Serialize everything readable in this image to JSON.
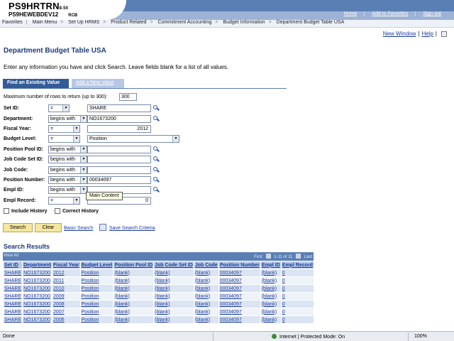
{
  "header": {
    "brand_main": "PS9HRTRN",
    "brand_version": "8.50",
    "brand_db": "PS9HEWEBDEV12",
    "brand_code": "RCB",
    "links": [
      "Home",
      "Add to Favorites",
      "Sign out"
    ]
  },
  "breadcrumb": [
    "Favorites",
    "Main Menu",
    "Set Up HRMS",
    "Product Related",
    "Commitment Accounting",
    "Budget Information",
    "Department Budget Table USA"
  ],
  "utility": {
    "new_window": "New Window",
    "help": "Help"
  },
  "page": {
    "title": "Department Budget Table USA",
    "instructions": "Enter any information you have and click Search. Leave fields blank for a list of all values."
  },
  "tabs": {
    "existing": "Find an Existing Value",
    "new": "Add a New Value"
  },
  "maxrows": {
    "label": "Maximum number of rows to return (up to 300):",
    "value": "300"
  },
  "fields": [
    {
      "label": "Set ID:",
      "op": "=",
      "value": "SHARE"
    },
    {
      "label": "Department:",
      "op": "begins with",
      "value": "NO1673200"
    },
    {
      "label": "Fiscal Year:",
      "op": "=",
      "value": "2012"
    },
    {
      "label": "Budget Level:",
      "op": "=",
      "value": "Position"
    },
    {
      "label": "Position Pool ID:",
      "op": "begins with",
      "value": ""
    },
    {
      "label": "Job Code Set ID:",
      "op": "begins with",
      "value": ""
    },
    {
      "label": "Job Code:",
      "op": "begins with",
      "value": ""
    },
    {
      "label": "Position Number:",
      "op": "begins with",
      "value": "00034097"
    },
    {
      "label": "Empl ID:",
      "op": "begins with",
      "value": ""
    },
    {
      "label": "Empl Record:",
      "op": "=",
      "value": "0"
    }
  ],
  "tooltip": "Main Content",
  "checkboxes": {
    "include_history": "Include History",
    "correct_history": "Correct History"
  },
  "buttons": {
    "search": "Search",
    "clear": "Clear",
    "basic_search": "Basic Search",
    "save_criteria": "Save Search Criteria"
  },
  "results": {
    "title": "Search Results",
    "view_all": "View All",
    "first": "First",
    "range": "1-11 of 11",
    "last": "Last",
    "columns": [
      "Set ID",
      "Department",
      "Fiscal Year",
      "Budget Level",
      "Position Pool ID",
      "Job Code Set ID",
      "Job Code",
      "Position Number",
      "Empl ID",
      "Empl Record"
    ],
    "rows": [
      [
        "SHARE",
        "NO1673200",
        "2012",
        "Position",
        "(blank)",
        "(blank)",
        "(blank)",
        "00034097",
        "(blank)",
        "0"
      ],
      [
        "SHARE",
        "NO1673200",
        "2011",
        "Position",
        "(blank)",
        "(blank)",
        "(blank)",
        "00034097",
        "(blank)",
        "0"
      ],
      [
        "SHARE",
        "NO1673200",
        "2010",
        "Position",
        "(blank)",
        "(blank)",
        "(blank)",
        "00034097",
        "(blank)",
        "0"
      ],
      [
        "SHARE",
        "NO1673200",
        "2009",
        "Position",
        "(blank)",
        "(blank)",
        "(blank)",
        "00034097",
        "(blank)",
        "0"
      ],
      [
        "SHARE",
        "NO1673200",
        "2008",
        "Position",
        "(blank)",
        "(blank)",
        "(blank)",
        "00034097",
        "(blank)",
        "0"
      ],
      [
        "SHARE",
        "NO1673200",
        "2007",
        "Position",
        "(blank)",
        "(blank)",
        "(blank)",
        "00034097",
        "(blank)",
        "0"
      ],
      [
        "SHARE",
        "NO1673200",
        "2006",
        "Position",
        "(blank)",
        "(blank)",
        "(blank)",
        "00034097",
        "(blank)",
        "0"
      ]
    ]
  },
  "statusbar": {
    "left": "Done",
    "zone": "Internet | Protected Mode: On",
    "zoom": "100%"
  }
}
